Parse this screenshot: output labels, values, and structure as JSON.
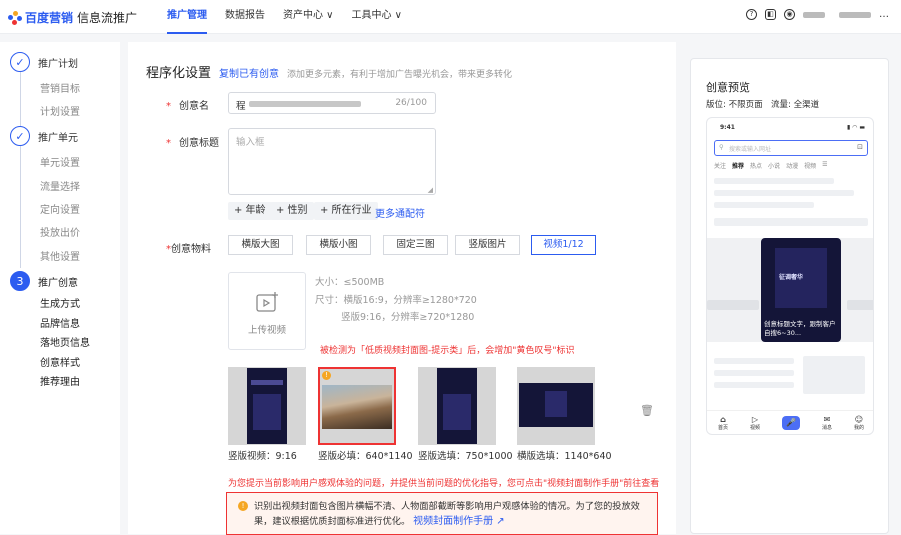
{
  "header": {
    "brand": "百度营销",
    "product": "信息流推广",
    "nav": [
      {
        "label": "推广管理"
      },
      {
        "label": "数据报告"
      },
      {
        "label": "资产中心 ∨"
      },
      {
        "label": "工具中心 ∨"
      }
    ]
  },
  "sidebar": {
    "step1": {
      "label": "推广计划",
      "subs": [
        "营销目标",
        "计划设置"
      ]
    },
    "step2": {
      "label": "推广单元",
      "subs": [
        "单元设置",
        "流量选择",
        "定向设置",
        "投放出价",
        "其他设置"
      ]
    },
    "step3": {
      "number": "3",
      "label": "推广创意",
      "subs": [
        "生成方式",
        "品牌信息",
        "落地页信息",
        "创意样式",
        "推荐理由"
      ]
    }
  },
  "main": {
    "title": "程序化设置",
    "copy_link": "复制已有创意",
    "hint": "添加更多元素，有利于增加广告曝光机会，带来更多转化",
    "name_label": "创意名",
    "name_value": "程",
    "name_count": "26/100",
    "title_label": "创意标题",
    "title_placeholder": "输入框",
    "tags": [
      "+ 年龄",
      "+ 性别",
      "+ 所在行业"
    ],
    "more_tags": "更多通配符",
    "material_label": "创意物料",
    "ratios": [
      "横版大图",
      "横版小图",
      "固定三图",
      "竖版图片",
      "视频1/12"
    ],
    "upload_label": "上传视频",
    "spec1": "大小：≤500MB",
    "spec2": "尺寸：横版16:9，分辨率≥1280*720",
    "spec3": "竖版9:16，分辨率≥720*1280",
    "detect_note": "被检测为「低质视频封面图-提示类」后，会增加\"黄色叹号\"标识",
    "thumbs": [
      {
        "caption": "竖版视频：9:16"
      },
      {
        "caption": "竖版必填：640*1140"
      },
      {
        "caption": "竖版选填：750*1000"
      },
      {
        "caption": "横版选填：1140*640"
      }
    ],
    "thumb_overlay": "征调奢华",
    "tip_red": "为您提示当前影响用户感观体验的问题，并提供当前问题的优化指导，您可点击\"视频封面制作手册\"前往查看",
    "warn_text": "识别出视频封面包含图片横幅不清、人物面部截断等影响用户观感体验的情况。为了您的投放效果，建议根据优质封面标准进行优化。",
    "warn_link": "视频封面制作手册"
  },
  "preview": {
    "title": "创意预览",
    "position": "版位:  不限页面",
    "traffic": "流量:  全渠道",
    "time": "9:41",
    "search_placeholder": "搜索或输入网址",
    "tabs": [
      "关注",
      "推荐",
      "热点",
      "小说",
      "动漫",
      "视频"
    ],
    "card_text": "创意标题文字，跟制客户自搜6~30...",
    "bottom_nav": [
      "首页",
      "视频",
      "",
      "消息",
      "我的"
    ]
  },
  "colors": {
    "accent": "#2c5cf0",
    "error": "#e33333",
    "warning": "#f5a623"
  }
}
